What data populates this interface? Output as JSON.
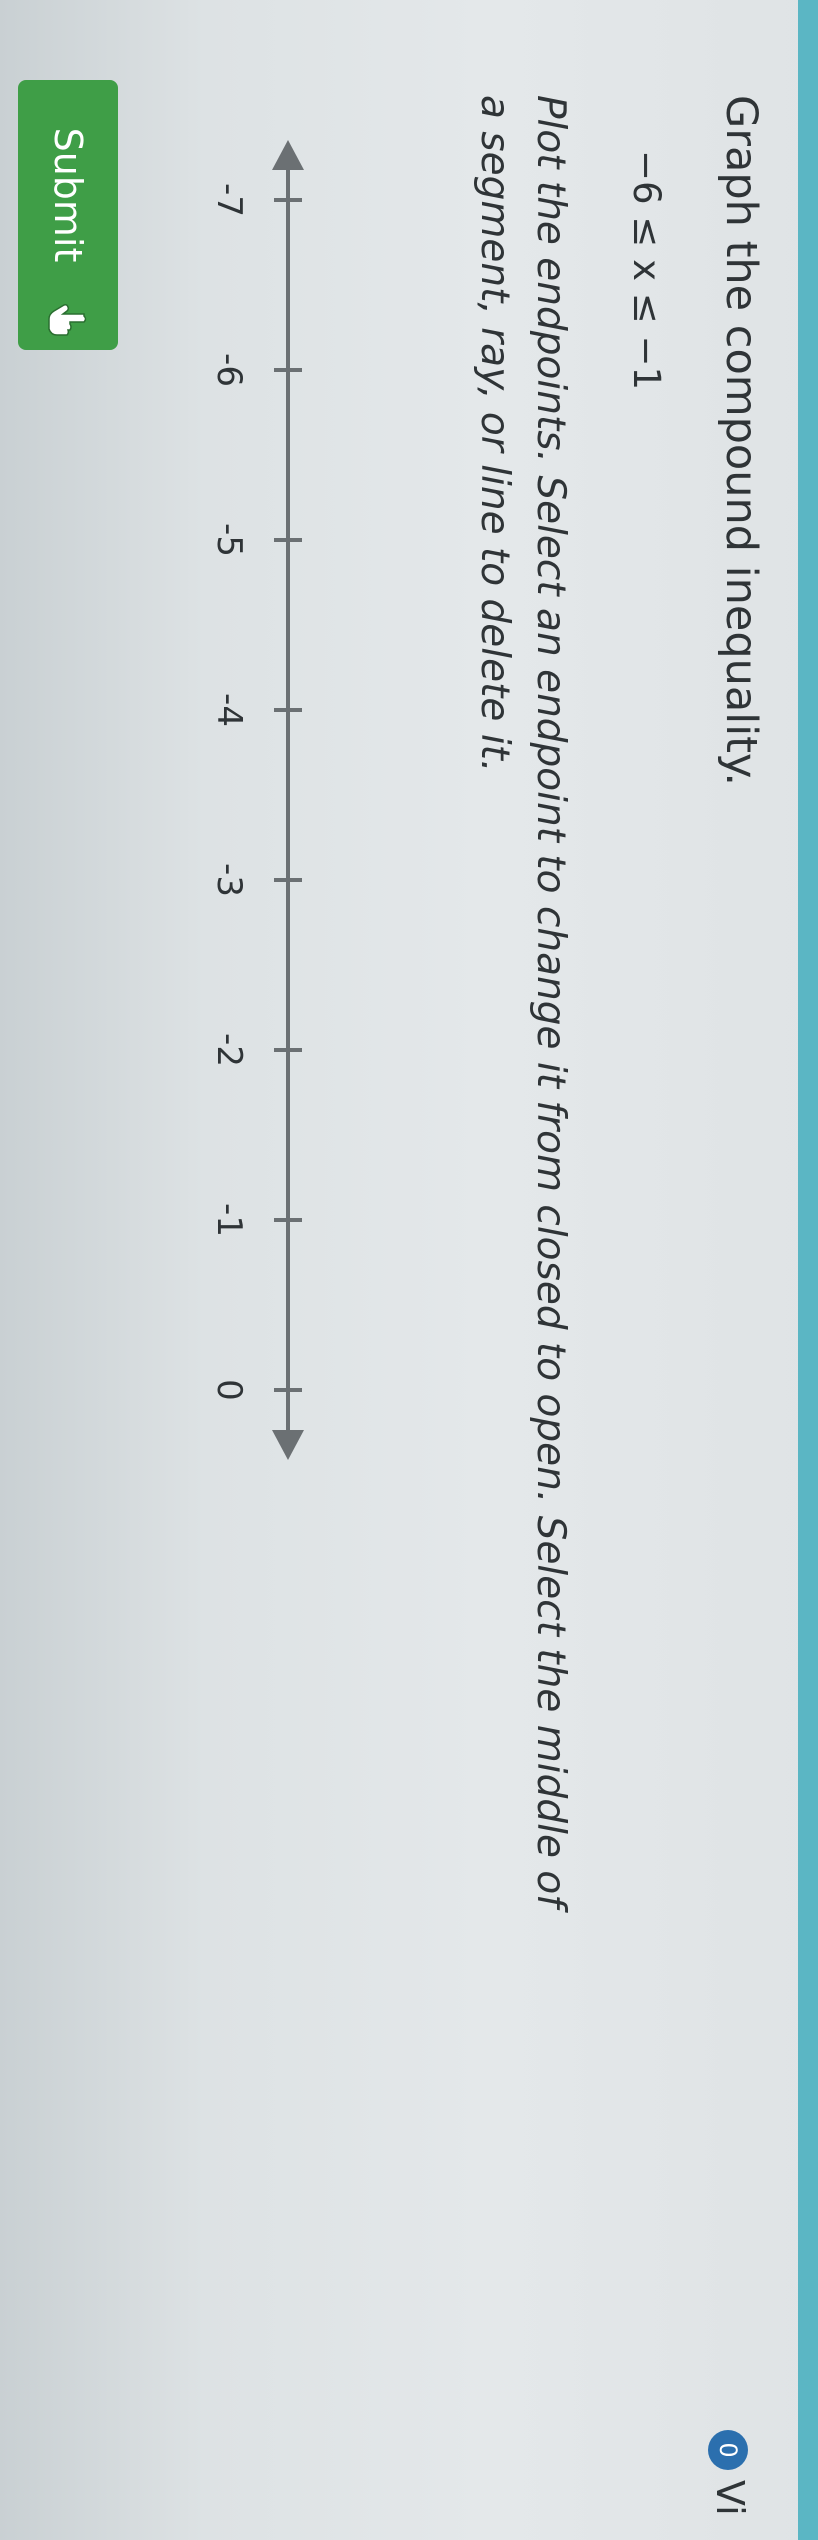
{
  "question": {
    "prompt": "Graph the compound inequality.",
    "inequality": "−6 ≤ x ≤ −1",
    "instructions_line1": "Plot the endpoints. Select an endpoint to change it from closed to open. Select the middle of",
    "instructions_line2": "a segment, ray, or line to delete it."
  },
  "number_line": {
    "min": -7,
    "max": 0,
    "tick_labels": [
      "-7",
      "-6",
      "-5",
      "-4",
      "-3",
      "-2",
      "-1",
      "0"
    ]
  },
  "submit": {
    "label": "Submit",
    "icon": "hand-pointer-icon"
  },
  "corner": {
    "badge_text": "0",
    "text": "Vi"
  },
  "colors": {
    "submit_bg": "#3f9e47",
    "accent": "#5bb6c4",
    "badge": "#2b6fae"
  }
}
